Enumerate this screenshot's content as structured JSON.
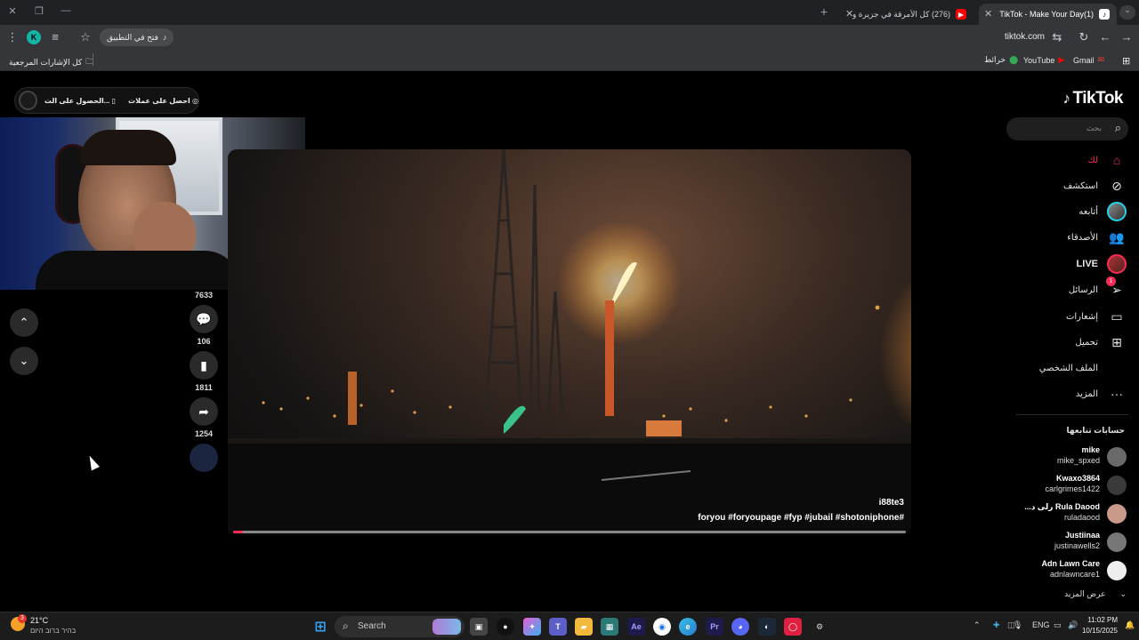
{
  "browser": {
    "tabs": [
      {
        "title": "(1)TikTok - Make Your Day",
        "active": true
      },
      {
        "title": "(276) كل الأمرقة في جزيرة وحدة!",
        "active": false
      }
    ],
    "url": "tiktok.com",
    "open_in_app": "فتح في التطبيق",
    "profile_letter": "K"
  },
  "bookmarks": {
    "items": [
      "Gmail",
      "YouTube",
      "خرائط"
    ],
    "all_bookmarks": "كل الإشارات المرجعية"
  },
  "tiktok": {
    "logo": "TikTok",
    "search_placeholder": "بحث",
    "menu": [
      {
        "label": "لك",
        "icon": "home-icon"
      },
      {
        "label": "استكشف",
        "icon": "compass-icon"
      },
      {
        "label": "أتابعه",
        "icon": "following-avatar"
      },
      {
        "label": "الأصدقاء",
        "icon": "friends-icon"
      },
      {
        "label": "LIVE",
        "icon": "live-avatar"
      },
      {
        "label": "الرسائل",
        "icon": "messages-icon",
        "badge": "1"
      },
      {
        "label": "إشعارات",
        "icon": "inbox-icon"
      },
      {
        "label": "تحميل",
        "icon": "upload-icon"
      },
      {
        "label": "الملف الشخصي",
        "icon": "profile-icon"
      },
      {
        "label": "المزيد",
        "icon": "more-icon"
      }
    ],
    "following_title": "حسابات تتابعها",
    "following": [
      {
        "name": "mike",
        "handle": "mike_spxed"
      },
      {
        "name": "Kwaxo3864",
        "handle": "carlgrimes1422"
      },
      {
        "name": "Rula Daood رلى د...",
        "handle": "ruladaood"
      },
      {
        "name": "Justiinaa",
        "handle": "justinawells2"
      },
      {
        "name": "Adn Lawn Care",
        "handle": "adnlawncare1"
      }
    ],
    "see_more": "عرض المزيد",
    "promo": {
      "effects": "احصل على عملات",
      "get_app": "الحصول على الت..."
    },
    "video": {
      "author": "i88te3",
      "tags": "#foryou #foryoupage #fyp #jubail #shotoniphone",
      "progress": 0.015
    },
    "actions": {
      "likes": "7633",
      "comments": "106",
      "saves": "1811",
      "shares": "1254"
    }
  },
  "taskbar": {
    "weather_temp": "21°C",
    "weather_desc": "בהיר ברוב היום",
    "weather_badge": "3",
    "search": "Search",
    "lang": "ENG",
    "time": "11:02 PM",
    "date": "10/15/2025"
  }
}
